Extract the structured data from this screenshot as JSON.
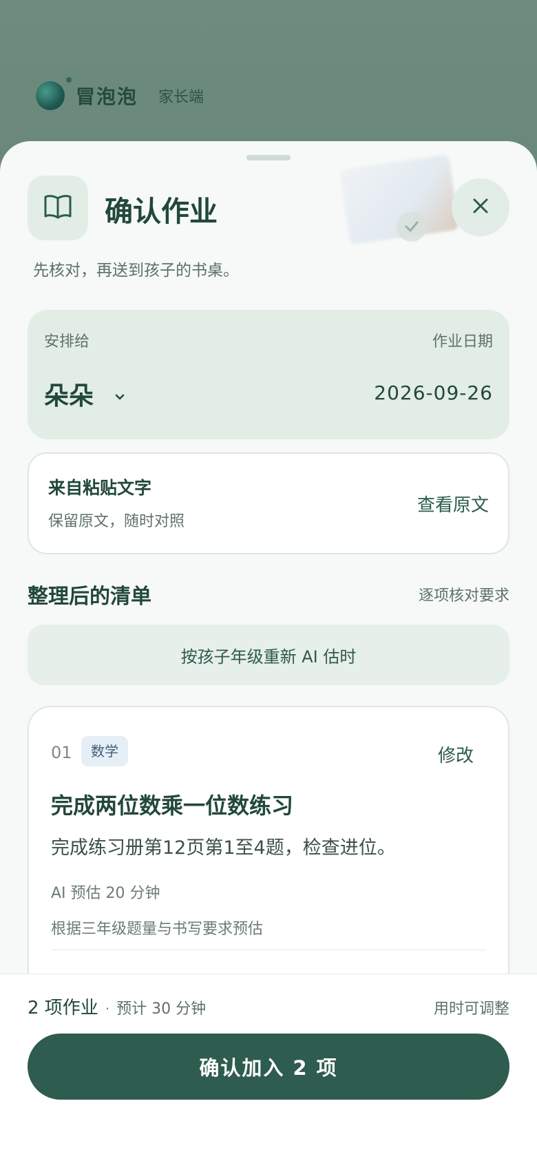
{
  "header": {
    "app_name": "冒泡泡",
    "role": "家长端"
  },
  "sheet": {
    "title": "确认作业",
    "subtitle": "先核对，再送到孩子的书桌。",
    "icons": {
      "book": "open-book-icon",
      "close": "close-icon",
      "decoration": "checked-book-illustration"
    }
  },
  "assign": {
    "label": "安排给",
    "child_name": "朵朵",
    "date_label": "作业日期",
    "date_value": "2026-09-26"
  },
  "source": {
    "title": "来自粘贴文字",
    "subtitle": "保留原文，随时对照",
    "view_link": "查看原文"
  },
  "list": {
    "title": "整理后的清单",
    "hint": "逐项核对要求",
    "ai_button": "按孩子年级重新 AI 估时",
    "tasks": [
      {
        "number": "01",
        "subject": "数学",
        "edit": "修改",
        "title": "完成两位数乘一位数练习",
        "description": "完成练习册第12页第1至4题，检查进位。",
        "estimate": "AI 预估 20 分钟",
        "basis": "根据三年级题量与书写要求预估"
      }
    ]
  },
  "footer": {
    "count": "2 项作业",
    "separator": "·",
    "estimate": "预计 30 分钟",
    "note": "用时可调整",
    "confirm_label": "确认加入 2 项"
  },
  "colors": {
    "primary": "#2e5c4e",
    "text_dark": "#22473b",
    "card_tint": "#e2ede6",
    "background": "#f6f9f7",
    "subject_tag": "#e6eef6"
  }
}
